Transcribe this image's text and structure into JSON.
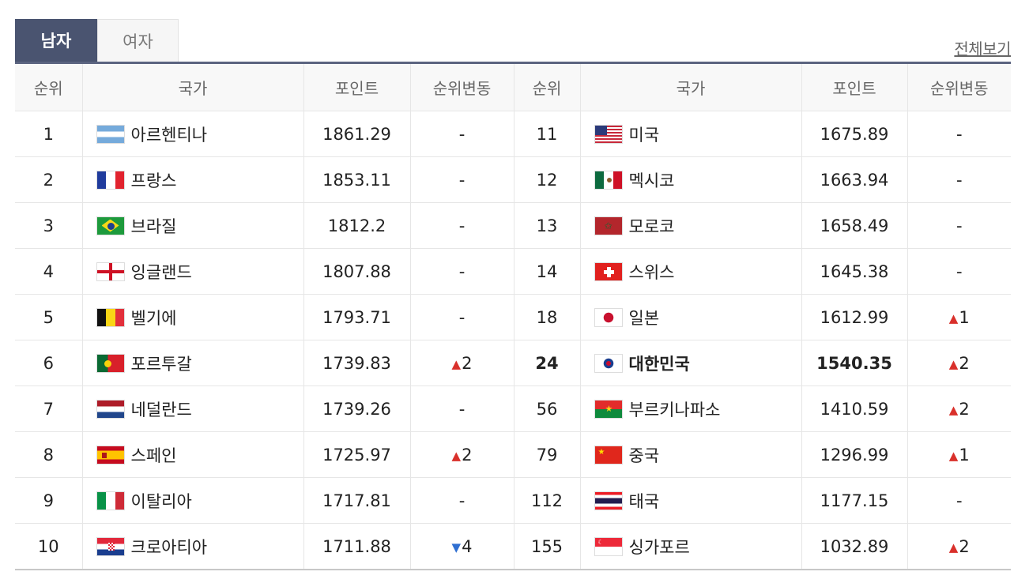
{
  "tabs": {
    "men": "남자",
    "women": "여자"
  },
  "view_all": "전체보기",
  "columns": [
    "순위",
    "국가",
    "포인트",
    "순위변동",
    "순위",
    "국가",
    "포인트",
    "순위변동"
  ],
  "left_rows": [
    {
      "rank": "1",
      "country": "아르헨티나",
      "points": "1861.29",
      "change": "-",
      "dir": "none",
      "flag": "argentina-flag"
    },
    {
      "rank": "2",
      "country": "프랑스",
      "points": "1853.11",
      "change": "-",
      "dir": "none",
      "flag": "france-flag"
    },
    {
      "rank": "3",
      "country": "브라질",
      "points": "1812.2",
      "change": "-",
      "dir": "none",
      "flag": "brazil-flag"
    },
    {
      "rank": "4",
      "country": "잉글랜드",
      "points": "1807.88",
      "change": "-",
      "dir": "none",
      "flag": "england-flag"
    },
    {
      "rank": "5",
      "country": "벨기에",
      "points": "1793.71",
      "change": "-",
      "dir": "none",
      "flag": "belgium-flag"
    },
    {
      "rank": "6",
      "country": "포르투갈",
      "points": "1739.83",
      "change": "2",
      "dir": "up",
      "flag": "portugal-flag"
    },
    {
      "rank": "7",
      "country": "네덜란드",
      "points": "1739.26",
      "change": "-",
      "dir": "none",
      "flag": "netherlands-flag"
    },
    {
      "rank": "8",
      "country": "스페인",
      "points": "1725.97",
      "change": "2",
      "dir": "up",
      "flag": "spain-flag"
    },
    {
      "rank": "9",
      "country": "이탈리아",
      "points": "1717.81",
      "change": "-",
      "dir": "none",
      "flag": "italy-flag"
    },
    {
      "rank": "10",
      "country": "크로아티아",
      "points": "1711.88",
      "change": "4",
      "dir": "down",
      "flag": "croatia-flag"
    }
  ],
  "right_rows": [
    {
      "rank": "11",
      "country": "미국",
      "points": "1675.89",
      "change": "-",
      "dir": "none",
      "flag": "usa-flag"
    },
    {
      "rank": "12",
      "country": "멕시코",
      "points": "1663.94",
      "change": "-",
      "dir": "none",
      "flag": "mexico-flag"
    },
    {
      "rank": "13",
      "country": "모로코",
      "points": "1658.49",
      "change": "-",
      "dir": "none",
      "flag": "morocco-flag"
    },
    {
      "rank": "14",
      "country": "스위스",
      "points": "1645.38",
      "change": "-",
      "dir": "none",
      "flag": "switzerland-flag"
    },
    {
      "rank": "18",
      "country": "일본",
      "points": "1612.99",
      "change": "1",
      "dir": "up",
      "flag": "japan-flag"
    },
    {
      "rank": "24",
      "country": "대한민국",
      "points": "1540.35",
      "change": "2",
      "dir": "up",
      "flag": "korea-flag",
      "highlight": true
    },
    {
      "rank": "56",
      "country": "부르키나파소",
      "points": "1410.59",
      "change": "2",
      "dir": "up",
      "flag": "burkina-faso-flag"
    },
    {
      "rank": "79",
      "country": "중국",
      "points": "1296.99",
      "change": "1",
      "dir": "up",
      "flag": "china-flag"
    },
    {
      "rank": "112",
      "country": "태국",
      "points": "1177.15",
      "change": "-",
      "dir": "none",
      "flag": "thailand-flag"
    },
    {
      "rank": "155",
      "country": "싱가포르",
      "points": "1032.89",
      "change": "2",
      "dir": "up",
      "flag": "singapore-flag"
    }
  ],
  "colors": {
    "tab_active": "#4a5470",
    "arrow_up": "#d9302b",
    "arrow_down": "#2f6fd1"
  }
}
